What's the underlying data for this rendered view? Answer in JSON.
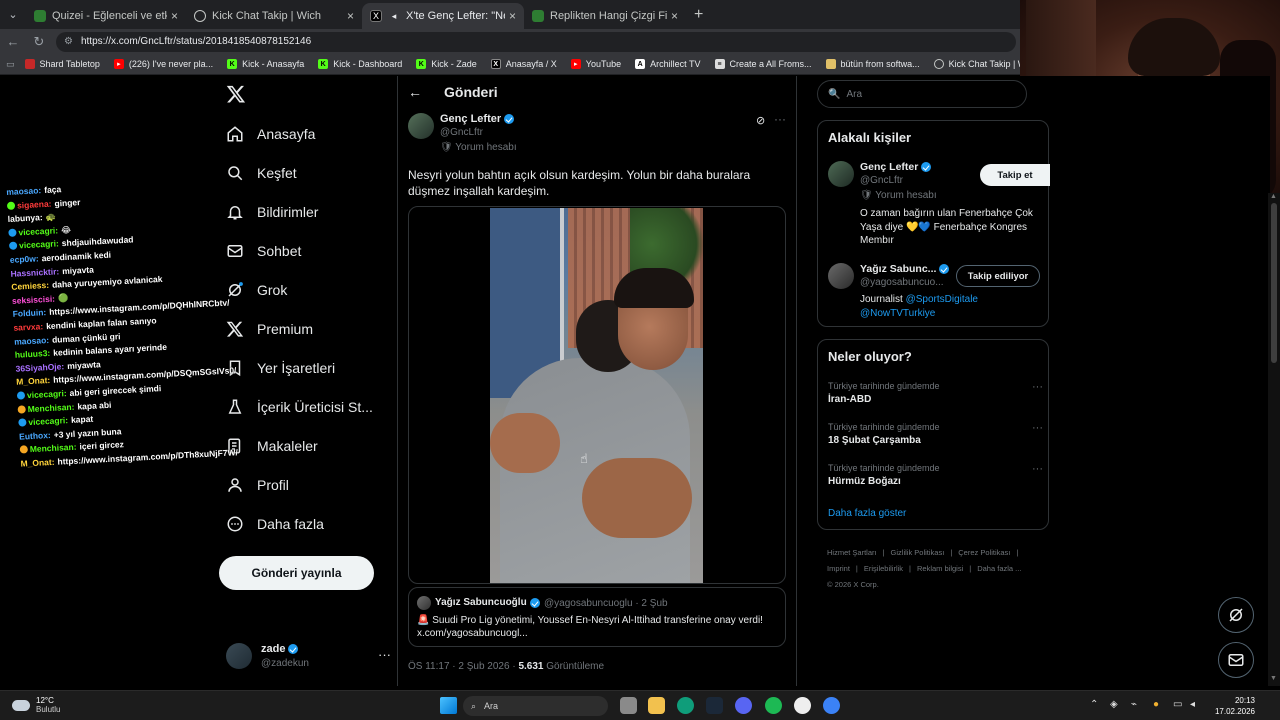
{
  "browser": {
    "tabs": [
      {
        "title": "Quizei - Eğlenceli ve etkileşimli qu",
        "active": false
      },
      {
        "title": "Kick Chat Takip | Wich",
        "active": false
      },
      {
        "title": "X'te Genç Lefter: \"Nesyri yolun",
        "active": true
      },
      {
        "title": "Replikten Hangi Çizgi Film Olduğu",
        "active": false
      }
    ],
    "url": "https://x.com/GncLftr/status/2018418540878152146",
    "bookmarks": [
      "Shard Tabletop",
      "(226) I've never pla...",
      "Kick - Anasayfa",
      "Kick - Dashboard",
      "Kick - Zade",
      "Anasayfa / X",
      "YouTube",
      "Archillect TV",
      "Create a All Froms...",
      "bütün from softwa...",
      "Kick Chat Takip | W..."
    ]
  },
  "chat": [
    {
      "user": "maosao:",
      "color": "#4aa8ff",
      "msg": "faça",
      "badge": ""
    },
    {
      "user": "sigaena:",
      "color": "#ff3b3b",
      "msg": "ginger",
      "badge": "green"
    },
    {
      "user": "labunya:",
      "color": "#ffffff",
      "msg": "🐢",
      "badge": ""
    },
    {
      "user": "vicecagri:",
      "color": "#53fc18",
      "msg": "😂",
      "badge": "blue"
    },
    {
      "user": "vicecagri:",
      "color": "#53fc18",
      "msg": "shdjauihdawudad",
      "badge": "blue"
    },
    {
      "user": "ecp0w:",
      "color": "#4aa8ff",
      "msg": "aerodinamik kedi",
      "badge": ""
    },
    {
      "user": "Hassnicktir:",
      "color": "#a970ff",
      "msg": "miyavta",
      "badge": ""
    },
    {
      "user": "Cemiess:",
      "color": "#ffd43b",
      "msg": "daha yuruyemiyo avlanicak",
      "badge": ""
    },
    {
      "user": "seksiscisi:",
      "color": "#ff4fd8",
      "msg": "🟢",
      "badge": ""
    },
    {
      "user": "Folduin:",
      "color": "#4aa8ff",
      "msg": "https://www.instagram.com/p/DQHhlNRCbtv/",
      "badge": ""
    },
    {
      "user": "sarvxa:",
      "color": "#ff3b3b",
      "msg": "kendini kaplan falan sanıyo",
      "badge": ""
    },
    {
      "user": "maosao:",
      "color": "#4aa8ff",
      "msg": "duman çünkü gri",
      "badge": ""
    },
    {
      "user": "huluus3:",
      "color": "#53fc18",
      "msg": "kedinin balans ayarı yerinde",
      "badge": ""
    },
    {
      "user": "36SiyahOje:",
      "color": "#a970ff",
      "msg": "miyawta",
      "badge": ""
    },
    {
      "user": "M_Onat:",
      "color": "#ffd43b",
      "msg": "https://www.instagram.com/p/DSQmSGsIVs0/",
      "badge": ""
    },
    {
      "user": "vicecagri:",
      "color": "#53fc18",
      "msg": "abi geri gireccek şimdi",
      "badge": "blue"
    },
    {
      "user": "Menchisan:",
      "color": "#53fc18",
      "msg": "kapa abi",
      "badge": "orange"
    },
    {
      "user": "vicecagri:",
      "color": "#53fc18",
      "msg": "kapat",
      "badge": "blue"
    },
    {
      "user": "Euthox:",
      "color": "#4aa8ff",
      "msg": "+3 yıl yazın buna",
      "badge": ""
    },
    {
      "user": "Menchisan:",
      "color": "#53fc18",
      "msg": "içeri gircez",
      "badge": "orange"
    },
    {
      "user": "M_Onat:",
      "color": "#ffd43b",
      "msg": "https://www.instagram.com/p/DTh8xuNjF7W/",
      "badge": ""
    }
  ],
  "sidebar": {
    "nav": [
      {
        "label": "Anasayfa",
        "icon": "home-icon"
      },
      {
        "label": "Keşfet",
        "icon": "search-icon"
      },
      {
        "label": "Bildirimler",
        "icon": "bell-icon"
      },
      {
        "label": "Sohbet",
        "icon": "mail-icon"
      },
      {
        "label": "Grok",
        "icon": "grok-icon"
      },
      {
        "label": "Premium",
        "icon": "x-logo-icon"
      },
      {
        "label": "Yer İşaretleri",
        "icon": "bookmark-icon"
      },
      {
        "label": "İçerik Üreticisi St...",
        "icon": "flask-icon"
      },
      {
        "label": "Makaleler",
        "icon": "article-icon"
      },
      {
        "label": "Profil",
        "icon": "user-icon"
      },
      {
        "label": "Daha fazla",
        "icon": "more-circle-icon"
      }
    ],
    "post_button": "Gönderi yayınla",
    "account": {
      "name": "zade",
      "handle": "@zadekun"
    }
  },
  "main": {
    "header": "Gönderi",
    "author": {
      "name": "Genç Lefter",
      "handle": "@GncLftr",
      "label": "Yorum hesabı"
    },
    "text": "Nesyri yolun bahtın açık olsun kardeşim. Yolun bir daha buralara düşmez inşallah kardeşim.",
    "quote": {
      "name": "Yağız Sabuncuoğlu",
      "handle": "@yagosabuncuoglu · 2 Şub",
      "text": "🚨 Suudi Pro Lig yönetimi, Youssef En-Nesyri Al-Ittihad transferine onay verdi! x.com/yagosabuncuogl..."
    },
    "meta_time": "ÖS 11:17 · 2 Şub 2026 · ",
    "meta_views": "5.631",
    "meta_views_label": " Görüntüleme"
  },
  "right": {
    "search_placeholder": "Ara",
    "related_title": "Alakalı kişiler",
    "people": [
      {
        "name": "Genç Lefter",
        "handle": "@GncLftr",
        "label": "Yorum hesabı",
        "bio": "O zaman bağırın ulan Fenerbahçe Çok Yaşa diye 💛💙 Fenerbahçe Kongres Membır",
        "button": "Takip et"
      },
      {
        "name": "Yağız Sabunc...",
        "handle": "@yagosabuncuo...",
        "bio_prefix": "Journalist ",
        "bio_link1": "@SportsDigitale",
        "bio_link2": "@NowTVTurkiye",
        "button": "Takip ediliyor"
      }
    ],
    "trends_title": "Neler oluyor?",
    "trends": [
      {
        "context": "Türkiye tarihinde gündemde",
        "title": "İran-ABD"
      },
      {
        "context": "Türkiye tarihinde gündemde",
        "title": "18 Şubat Çarşamba"
      },
      {
        "context": "Türkiye tarihinde gündemde",
        "title": "Hürmüz Boğazı"
      }
    ],
    "show_more": "Daha fazla göster",
    "footer": [
      "Hizmet Şartları",
      "|",
      "Gizlilik Politikası",
      "|",
      "Çerez Politikası",
      "|",
      "Imprint",
      "|",
      "Erişilebilirlik",
      "|",
      "Reklam bilgisi",
      "|",
      "Daha fazla ...",
      "© 2026 X Corp."
    ]
  },
  "taskbar": {
    "temp": "12°C",
    "weather": "Bulutlu",
    "search": "Ara",
    "time": "20:13",
    "date": "17.02.2026"
  }
}
